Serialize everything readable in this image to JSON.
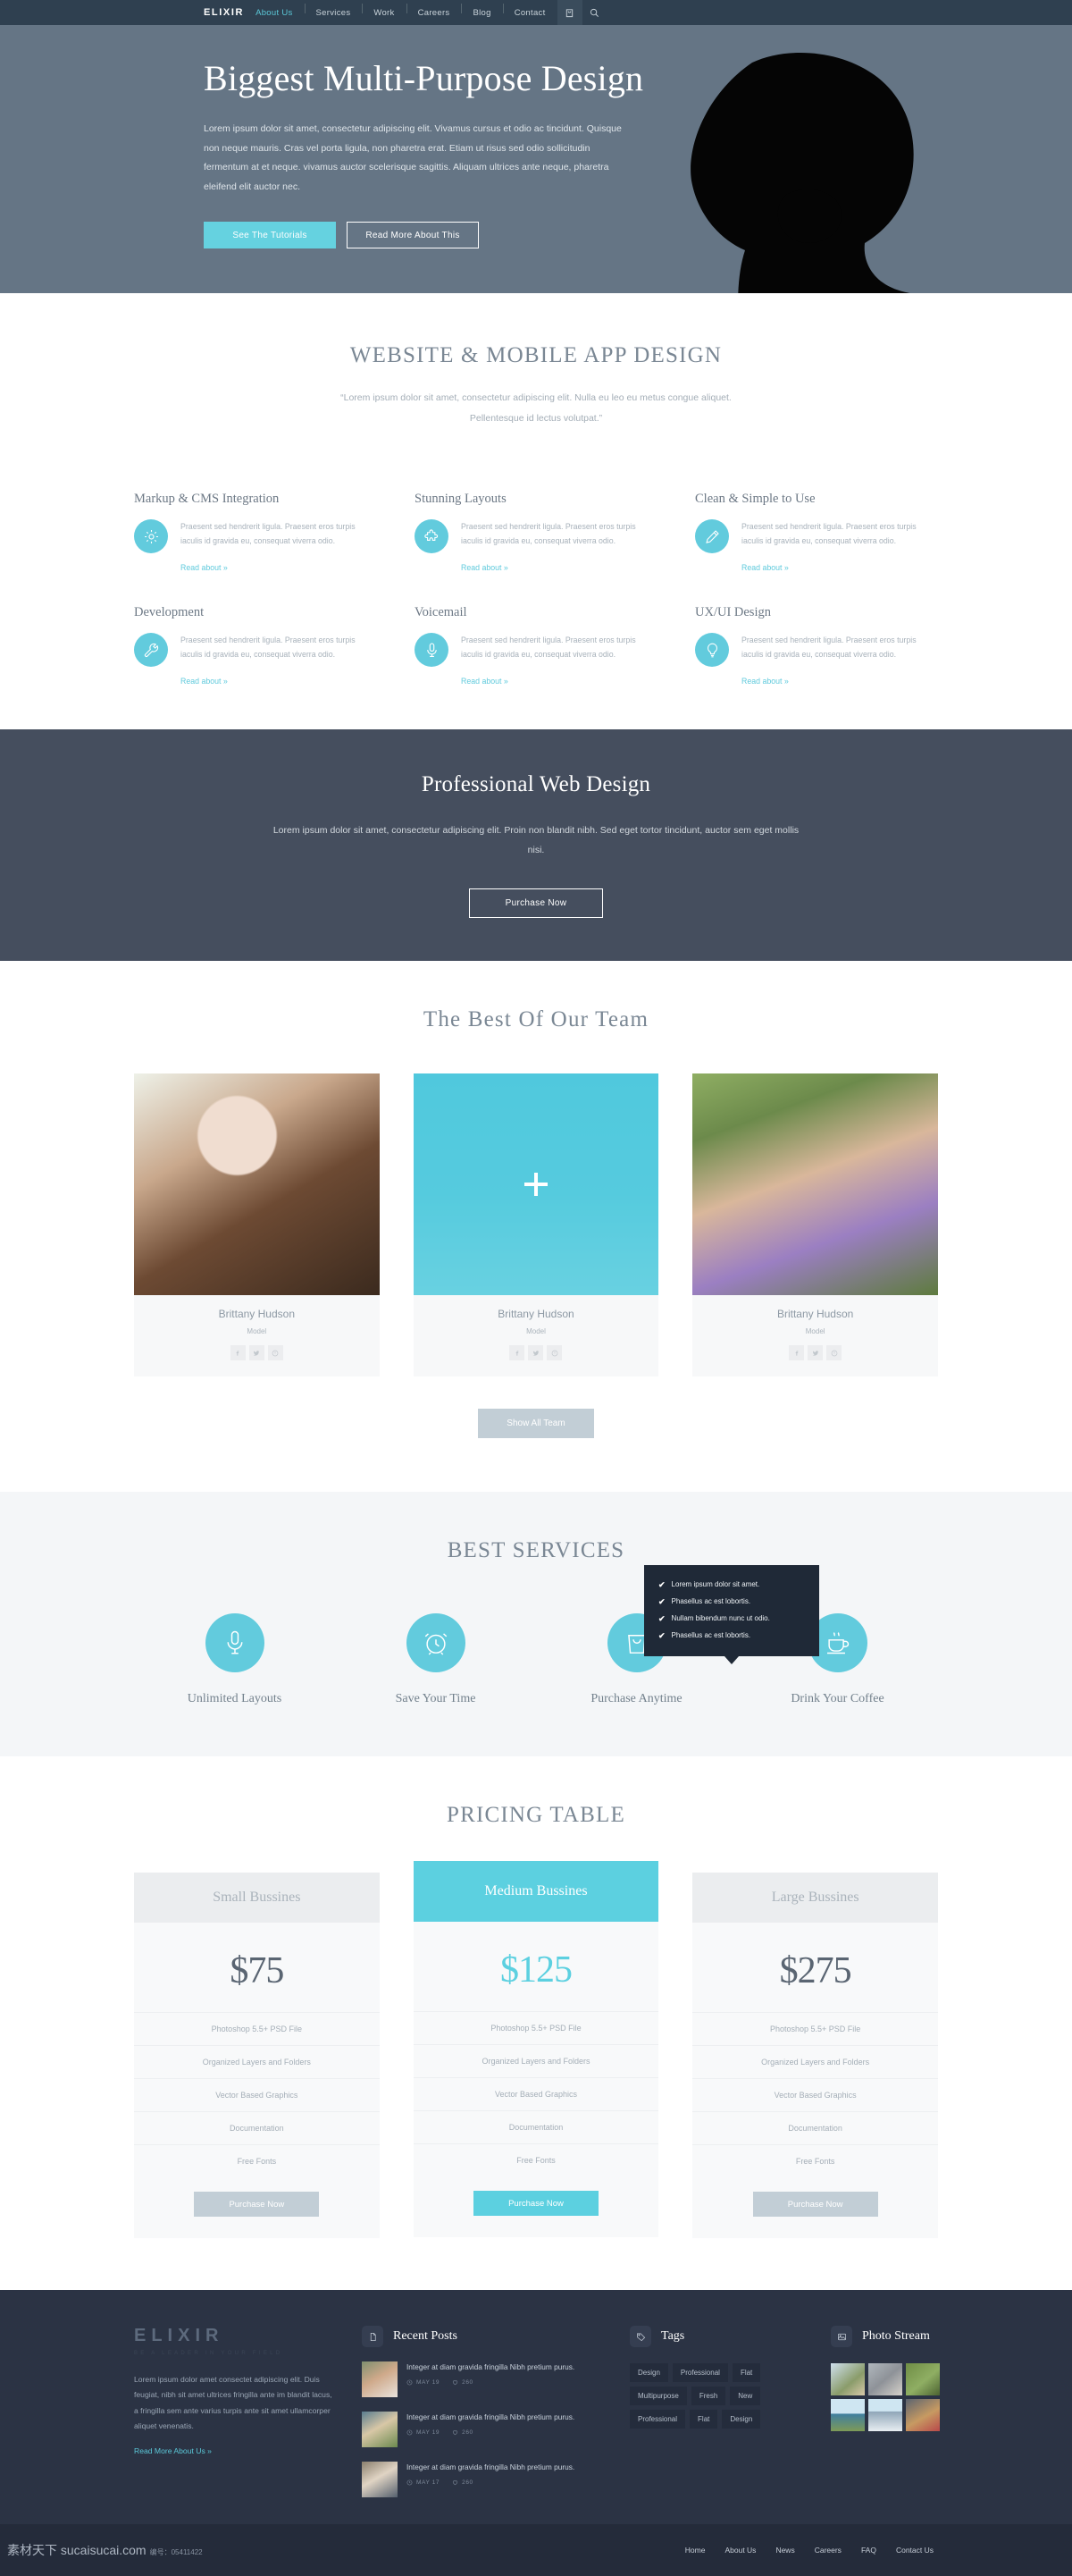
{
  "nav": {
    "brand": "ELIXIR",
    "items": [
      {
        "label": "About Us",
        "active": true
      },
      {
        "label": "Services",
        "active": false
      },
      {
        "label": "Work",
        "active": false
      },
      {
        "label": "Careers",
        "active": false
      },
      {
        "label": "Blog",
        "active": false
      },
      {
        "label": "Contact",
        "active": false
      }
    ],
    "cart_icon": "cart-icon",
    "search_icon": "search-icon"
  },
  "hero": {
    "title": "Biggest Multi-Purpose Design",
    "paragraph": "Lorem ipsum dolor sit amet, consectetur adipiscing elit. Vivamus cursus et odio ac tincidunt. Quisque non neque mauris. Cras vel porta ligula, non pharetra erat. Etiam ut risus sed odio sollicitudin fermentum at et neque. vivamus auctor scelerisque sagittis. Aliquam ultrices ante neque, pharetra eleifend elit auctor nec.",
    "primary_button": "See The Tutorials",
    "secondary_button": "Read More About This"
  },
  "features_section": {
    "title": "WEBSITE & MOBILE APP DESIGN",
    "subtitle_line1": "“Lorem ipsum dolor sit amet, consectetur adipiscing elit. Nulla eu leo eu metus congue aliquet.",
    "subtitle_line2": "Pellentesque id lectus volutpat.”",
    "items": [
      {
        "title": "Markup & CMS Integration",
        "text": "Praesent sed hendrerit ligula. Praesent eros turpis iaculis id gravida eu, consequat viverra odio.",
        "link": "Read about »",
        "icon": "gear-icon"
      },
      {
        "title": "Stunning Layouts",
        "text": "Praesent sed hendrerit ligula. Praesent eros turpis iaculis id gravida eu, consequat viverra odio.",
        "link": "Read about »",
        "icon": "puzzle-icon"
      },
      {
        "title": "Clean & Simple to Use",
        "text": "Praesent sed hendrerit ligula. Praesent eros turpis iaculis id gravida eu, consequat viverra odio.",
        "link": "Read about »",
        "icon": "pencil-icon"
      },
      {
        "title": "Development",
        "text": "Praesent sed hendrerit ligula. Praesent eros turpis iaculis id gravida eu, consequat viverra odio.",
        "link": "Read about »",
        "icon": "wrench-icon"
      },
      {
        "title": "Voicemail",
        "text": "Praesent sed hendrerit ligula. Praesent eros turpis iaculis id gravida eu, consequat viverra odio.",
        "link": "Read about »",
        "icon": "microphone-icon"
      },
      {
        "title": "UX/UI Design",
        "text": "Praesent sed hendrerit ligula. Praesent eros turpis iaculis id gravida eu, consequat viverra odio.",
        "link": "Read about »",
        "icon": "lightbulb-icon"
      }
    ]
  },
  "cta": {
    "title": "Professional Web Design",
    "paragraph": "Lorem ipsum dolor sit amet, consectetur adipiscing elit. Proin non blandit nibh. Sed eget tortor tincidunt, auctor sem eget mollis nisi.",
    "button": "Purchase Now"
  },
  "team": {
    "title": "The Best Of Our Team",
    "members": [
      {
        "name": "Brittany Hudson",
        "role": "Model"
      },
      {
        "name": "Brittany Hudson",
        "role": "Model"
      },
      {
        "name": "Brittany Hudson",
        "role": "Model"
      }
    ],
    "social_icons": [
      "facebook-icon",
      "twitter-icon",
      "pinterest-icon"
    ],
    "show_all_button": "Show All Team"
  },
  "services": {
    "title": "BEST SERVICES",
    "tooltip_items": [
      "Lorem ipsum dolor sit amet.",
      "Phasellus ac est lobortis.",
      "Nullam bibendum nunc ut odio.",
      "Phasellus ac est lobortis."
    ],
    "items": [
      {
        "label": "Unlimited Layouts",
        "icon": "microphone-icon"
      },
      {
        "label": "Save Your Time",
        "icon": "alarm-clock-icon"
      },
      {
        "label": "Purchase Anytime",
        "icon": "shopping-bag-icon"
      },
      {
        "label": "Drink Your Coffee",
        "icon": "coffee-cup-icon"
      }
    ]
  },
  "pricing": {
    "title": "PRICING TABLE",
    "features": [
      "Photoshop 5.5+ PSD File",
      "Organized Layers and Folders",
      "Vector Based Graphics",
      "Documentation",
      "Free Fonts"
    ],
    "plans": [
      {
        "name": "Small Bussines",
        "price": "$75",
        "button": "Purchase Now",
        "featured": false
      },
      {
        "name": "Medium Bussines",
        "price": "$125",
        "button": "Purchase Now",
        "featured": true
      },
      {
        "name": "Large Bussines",
        "price": "$275",
        "button": "Purchase Now",
        "featured": false
      }
    ]
  },
  "footer": {
    "logo": "ELIXIR",
    "tagline": "BE A LEADER IN YOUR FIELD",
    "about": "Lorem ipsum dolor amet consectet adipiscing elit. Duis feugiat, nibh sit amet ultrices fringilla ante im blandit lacus, a fringilla sem ante varius turpis ante sit amet ullamcorper aliquet venenatis.",
    "about_link": "Read More About Us »",
    "recent_posts": {
      "heading": "Recent Posts",
      "icon": "document-icon",
      "items": [
        {
          "title": "Integer at diam gravida fringilla Nibh pretium purus.",
          "date": "MAY 19",
          "likes": "260"
        },
        {
          "title": "Integer at diam gravida fringilla Nibh pretium purus.",
          "date": "MAY 19",
          "likes": "260"
        },
        {
          "title": "Integer at diam gravida fringilla Nibh pretium purus.",
          "date": "MAY 17",
          "likes": "260"
        }
      ]
    },
    "tags": {
      "heading": "Tags",
      "icon": "tag-icon",
      "items": [
        "Design",
        "Professional",
        "Flat",
        "Multipurpose",
        "Fresh",
        "New",
        "Professional",
        "Flat",
        "Design"
      ]
    },
    "photo_stream": {
      "heading": "Photo Stream",
      "icon": "image-icon",
      "count": 6
    }
  },
  "bottom": {
    "copyright_main": "素材天下 sucaisucai.com",
    "copyright_sub": "编号：05411422",
    "links": [
      "Home",
      "About Us",
      "News",
      "Careers",
      "FAQ",
      "Contact Us"
    ]
  },
  "colors": {
    "accent": "#62cbdd",
    "nav_bg": "#2f4050",
    "hero_bg": "#657585",
    "cta_bg": "#454e5e",
    "footer_bg": "#2b3344",
    "bottom_bg": "#242b3a"
  }
}
